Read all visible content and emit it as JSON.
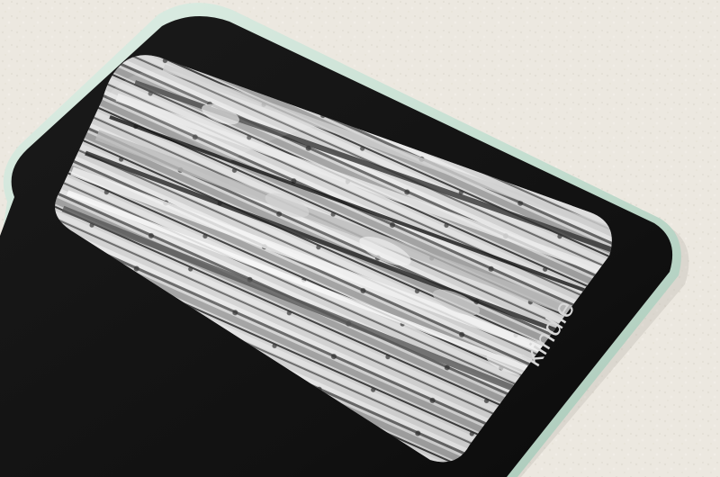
{
  "scene": {
    "subject": "kindle-ereader",
    "surface_color": "#ebe7df",
    "case_color": "#c9e3d5",
    "bezel_color": "#151515",
    "screen_palette": [
      "#e8e8e8",
      "#b7b7b7",
      "#7d7d7d",
      "#3e3e3e",
      "#121212"
    ]
  },
  "device": {
    "logo_text": "kindle"
  }
}
